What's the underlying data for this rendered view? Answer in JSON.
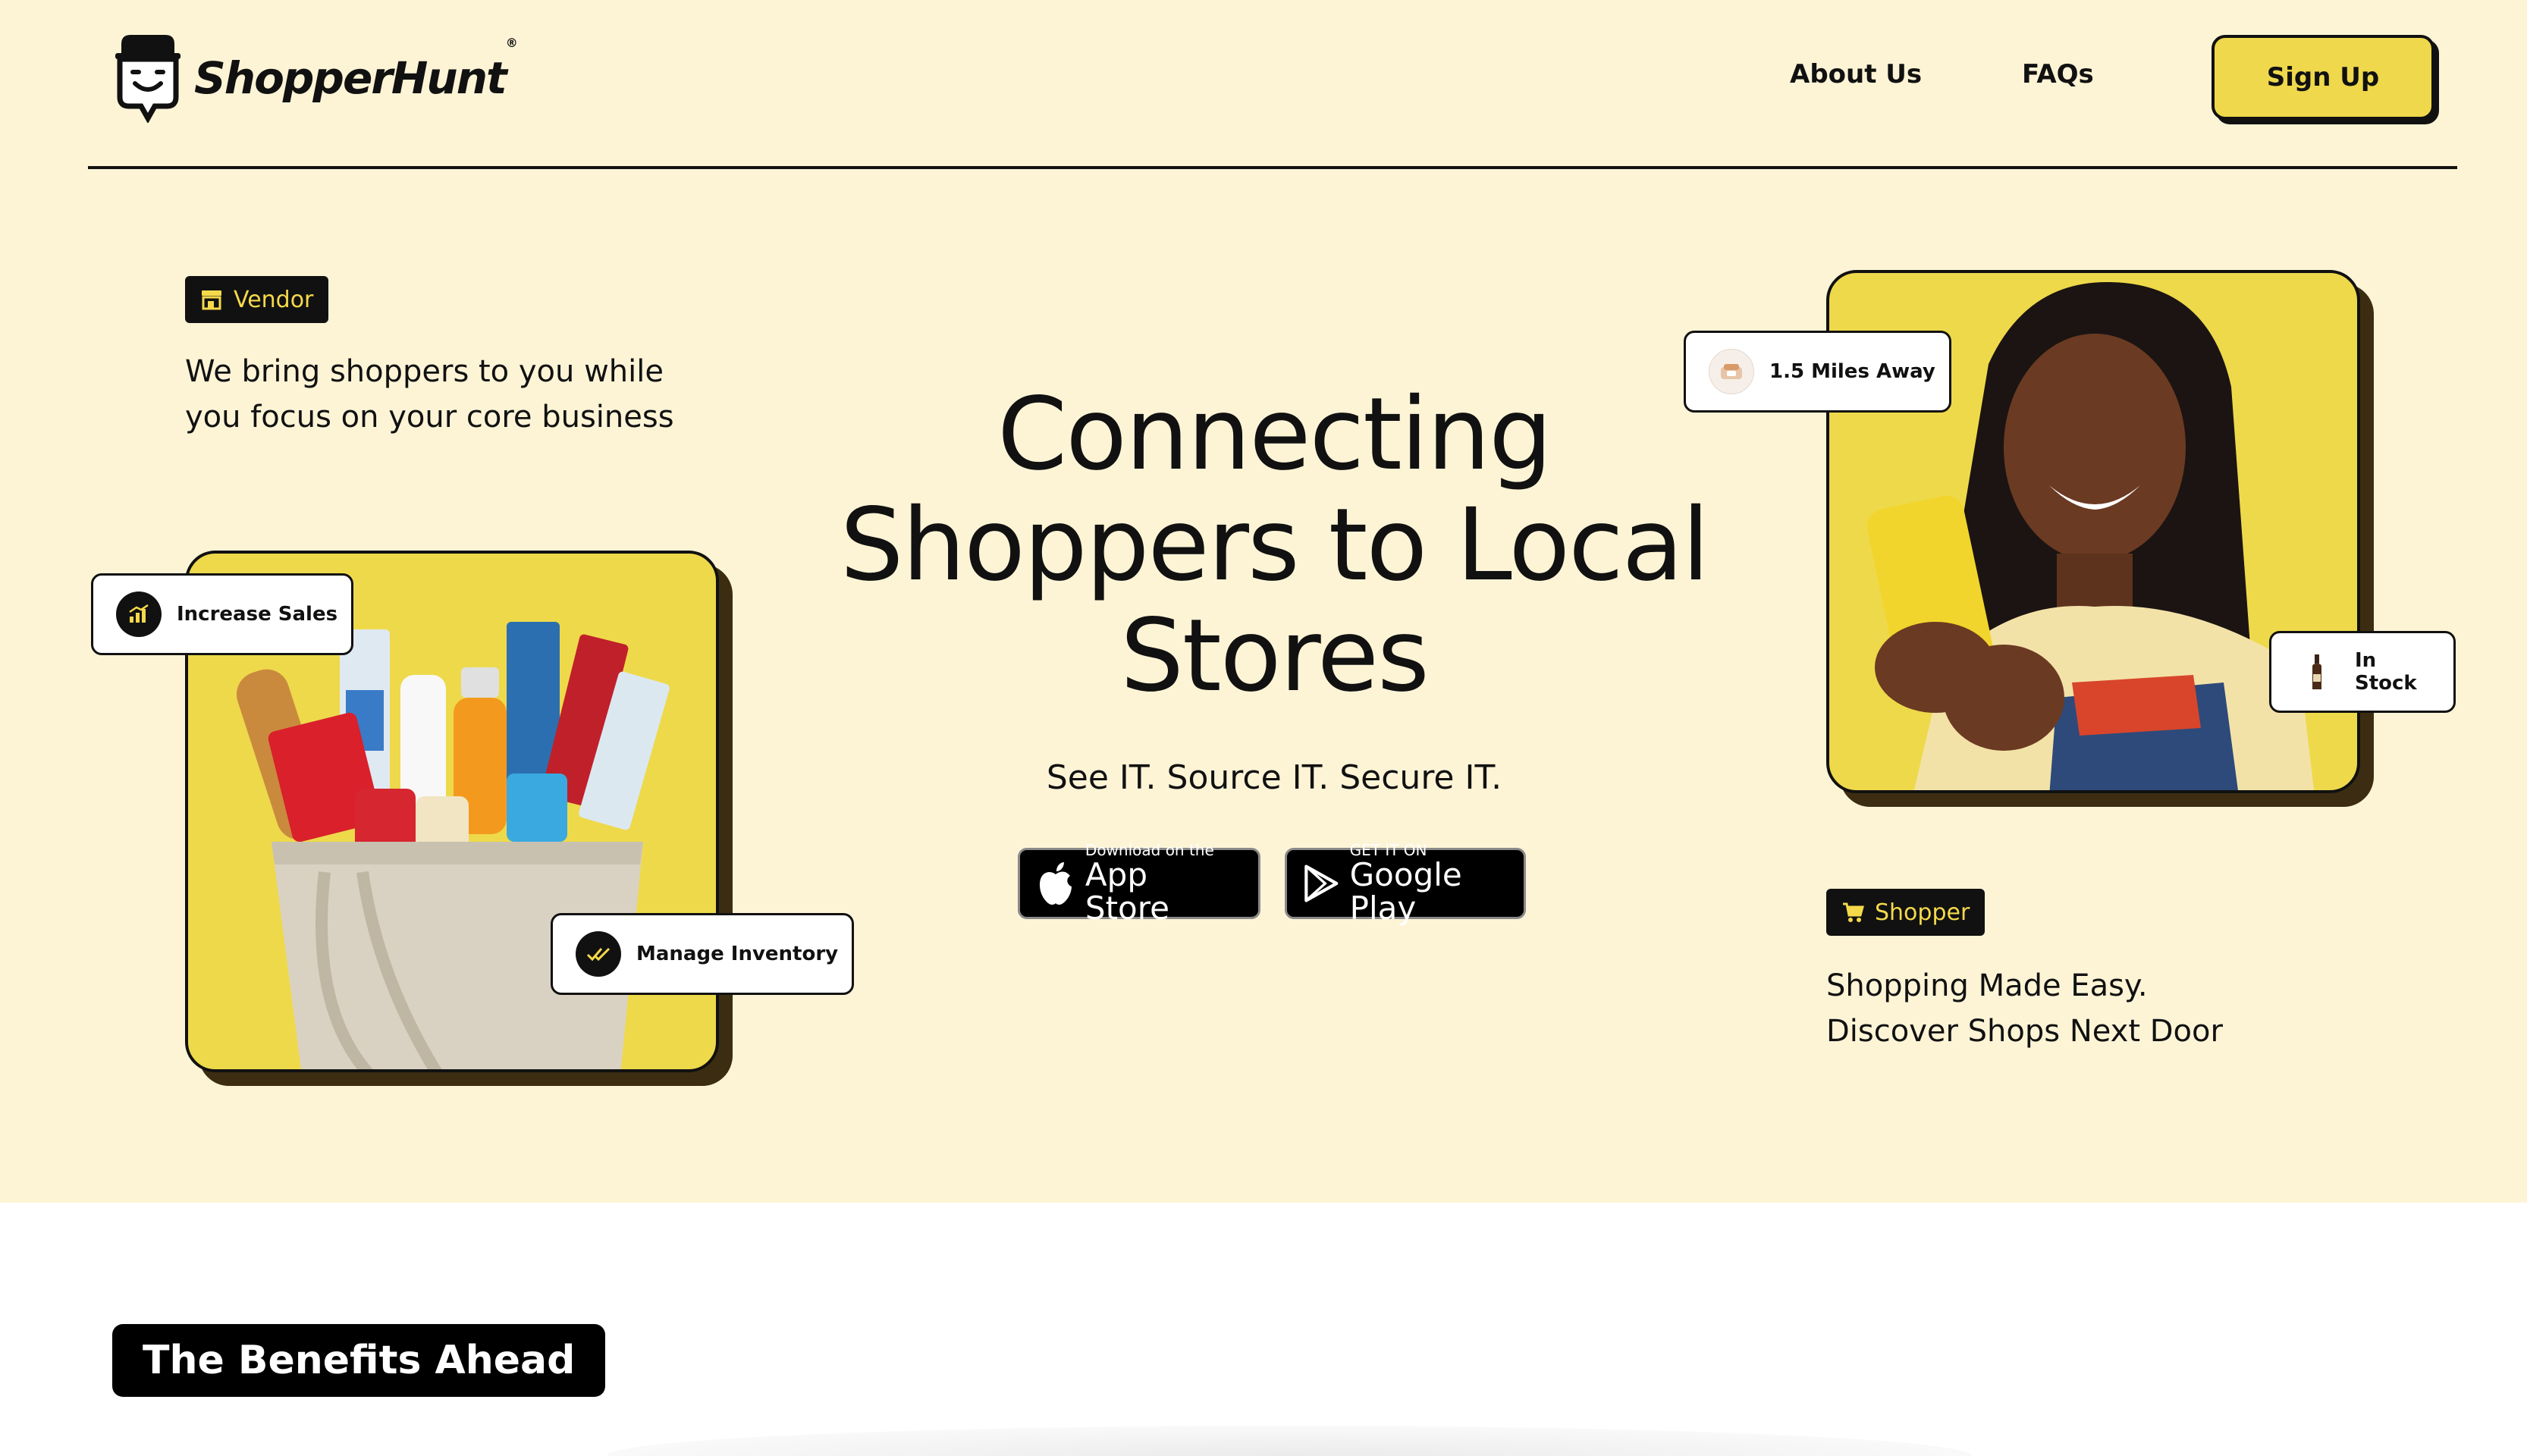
{
  "brand": {
    "name": "ShopperHunt",
    "reg": "®"
  },
  "nav": {
    "about": "About Us",
    "faqs": "FAQs",
    "signup": "Sign Up"
  },
  "vendor": {
    "tag": "Vendor",
    "desc_line1": "We bring shoppers to you while",
    "desc_line2": "you focus on your core business",
    "pill_sales": "Increase Sales",
    "pill_inventory": "Manage Inventory"
  },
  "hero": {
    "title_line1": "Connecting",
    "title_line2": "Shoppers to Local",
    "title_line3": "Stores",
    "tagline": "See IT. Source IT. Secure IT."
  },
  "stores": {
    "appstore_small": "Download on the",
    "appstore_big": "App Store",
    "googleplay_small": "GET IT ON",
    "googleplay_big": "Google Play"
  },
  "shopper": {
    "tag": "Shopper",
    "desc_line1": "Shopping Made Easy.",
    "desc_line2": "Discover Shops Next Door",
    "pill_distance": "1.5 Miles Away",
    "pill_stock": "In Stock"
  },
  "benefits": {
    "title": "The Benefits Ahead"
  },
  "colors": {
    "background": "#fdf4d6",
    "accent": "#efd84b",
    "dark": "#111111",
    "tag_text": "#f5d94b"
  },
  "icons": [
    "logo-mascot-icon",
    "store-icon",
    "chart-up-icon",
    "double-check-icon",
    "location-icon",
    "bottle-icon",
    "cart-icon",
    "apple-icon",
    "play-icon"
  ]
}
